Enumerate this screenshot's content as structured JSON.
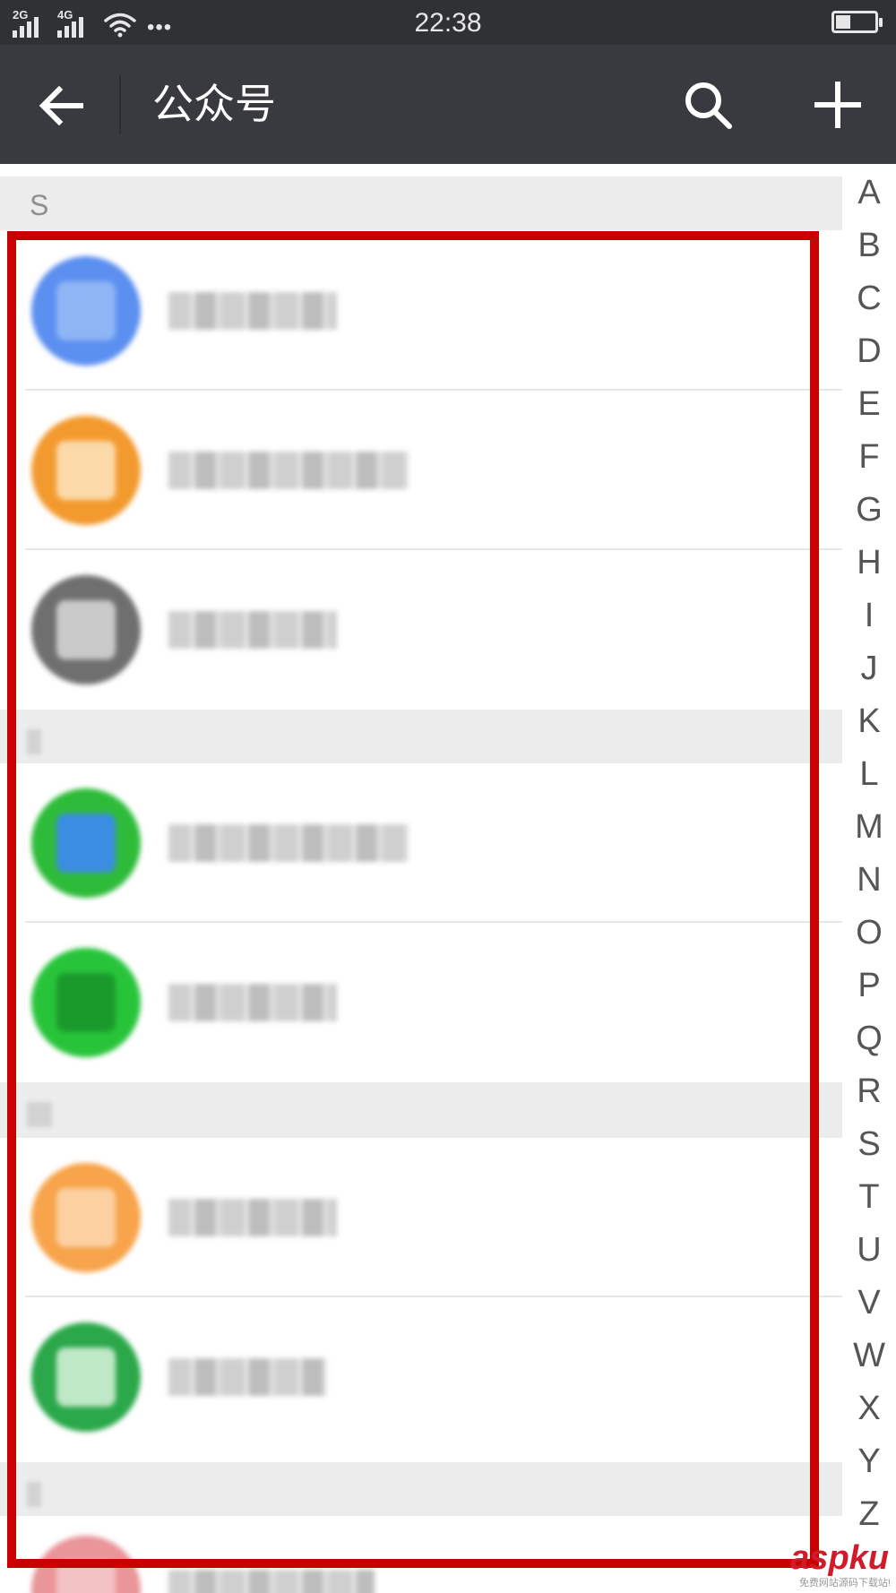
{
  "status_bar": {
    "network_1": "2G",
    "network_2": "4G",
    "more_icon": "more-dots-icon",
    "time": "22:38",
    "battery_level": 0.35
  },
  "header": {
    "back_icon": "arrow-left-icon",
    "title": "公众号",
    "search_icon": "search-icon",
    "add_icon": "plus-icon"
  },
  "list": {
    "first_section": "S",
    "accounts": [
      {
        "name": "",
        "avatar_color": "#5b8ff0",
        "avatar_inner": "#8fb5f5"
      },
      {
        "name": "",
        "avatar_color": "#f39a2e",
        "avatar_inner": "#fbd9a8"
      },
      {
        "name": "",
        "avatar_color": "#6f6f6f",
        "avatar_inner": "#c9c9c9"
      },
      {
        "name": "",
        "avatar_color": "#2ebb3a",
        "avatar_inner": "#3b8de3"
      },
      {
        "name": "",
        "avatar_color": "#27c43a",
        "avatar_inner": "#1b9a2c"
      },
      {
        "name": "",
        "avatar_color": "#f7a44a",
        "avatar_inner": "#fcd0a0"
      },
      {
        "name": "",
        "avatar_color": "#2aa84a",
        "avatar_inner": "#bfe8c7"
      },
      {
        "name": "",
        "avatar_color": "#e9959a",
        "avatar_inner": "#f3c2c5"
      }
    ]
  },
  "index_letters": [
    "A",
    "B",
    "C",
    "D",
    "E",
    "F",
    "G",
    "H",
    "I",
    "J",
    "K",
    "L",
    "M",
    "N",
    "O",
    "P",
    "Q",
    "R",
    "S",
    "T",
    "U",
    "V",
    "W",
    "X",
    "Y",
    "Z"
  ],
  "highlight_color": "#c80000",
  "watermark": {
    "main": "aspku",
    "sub": "免费网站源码下载站!"
  }
}
